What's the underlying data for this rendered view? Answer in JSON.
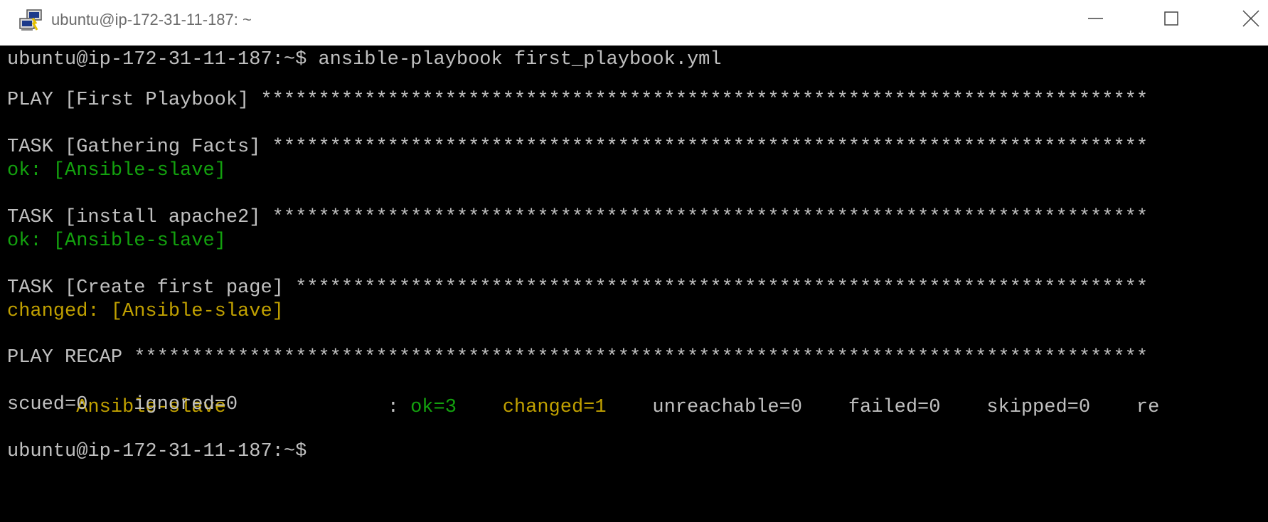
{
  "window": {
    "title": "ubuntu@ip-172-31-11-187: ~",
    "icon": "putty-icon",
    "controls": [
      "minimize-icon",
      "maximize-icon",
      "close-icon"
    ]
  },
  "colors": {
    "background": "#000000",
    "default_text": "#c0c0c0",
    "ok": "#13a10e",
    "changed": "#c0a000"
  },
  "terminal": {
    "lines": [
      {
        "text": "ubuntu@ip-172-31-11-187:~$ ansible-playbook first_playbook.yml",
        "color": "gray"
      },
      {
        "text": "PLAY [First Playbook] *****************************************************************************",
        "color": "gray"
      },
      {
        "text": "TASK [Gathering Facts] ****************************************************************************",
        "color": "gray"
      },
      {
        "text": "ok: [Ansible-slave]",
        "color": "green"
      },
      {
        "text": "TASK [install apache2] ****************************************************************************",
        "color": "gray"
      },
      {
        "text": "ok: [Ansible-slave]",
        "color": "green"
      },
      {
        "text": "TASK [Create first page] **************************************************************************",
        "color": "gray"
      },
      {
        "text": "changed: [Ansible-slave]",
        "color": "yellow"
      },
      {
        "text": "PLAY RECAP ****************************************************************************************",
        "color": "gray"
      },
      {
        "segments": [
          {
            "text": "Ansible-slave",
            "color": "yellow"
          },
          {
            "text": "              : ",
            "color": "gray"
          },
          {
            "text": "ok=3",
            "color": "green"
          },
          {
            "text": "    ",
            "color": "gray"
          },
          {
            "text": "changed=1",
            "color": "yellow"
          },
          {
            "text": "    unreachable=0    failed=0    skipped=0    re",
            "color": "gray"
          }
        ]
      },
      {
        "text": "scued=0    ignored=0",
        "color": "gray"
      },
      {
        "text": "ubuntu@ip-172-31-11-187:~$",
        "color": "gray"
      }
    ]
  }
}
